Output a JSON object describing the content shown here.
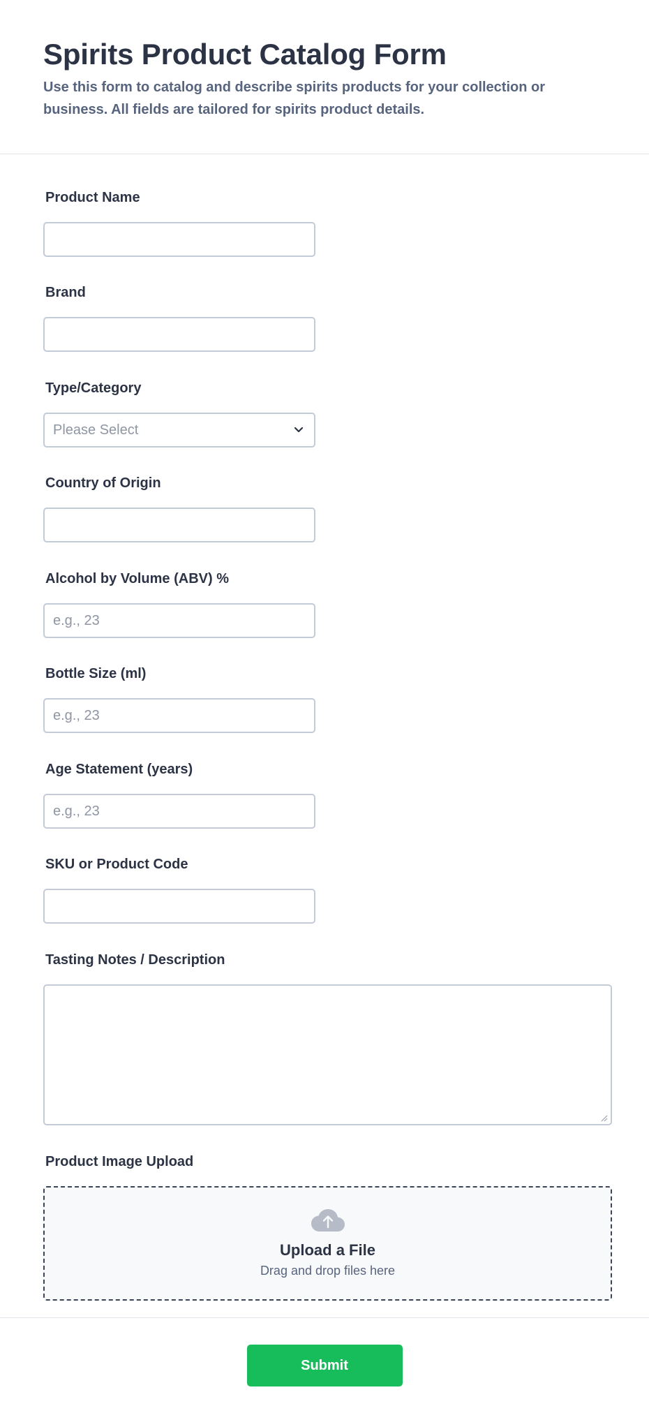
{
  "form": {
    "title": "Spirits Product Catalog Form",
    "subtitle": "Use this form to catalog and describe spirits products for your collection or business. All fields are tailored for spirits product details."
  },
  "fields": {
    "product_name": {
      "label": "Product Name",
      "value": ""
    },
    "brand": {
      "label": "Brand",
      "value": ""
    },
    "type_category": {
      "label": "Type/Category",
      "selected": "Please Select"
    },
    "country_of_origin": {
      "label": "Country of Origin",
      "value": ""
    },
    "abv": {
      "label": "Alcohol by Volume (ABV) %",
      "placeholder": "e.g., 23"
    },
    "bottle_size": {
      "label": "Bottle Size (ml)",
      "placeholder": "e.g., 23"
    },
    "age_statement": {
      "label": "Age Statement (years)",
      "placeholder": "e.g., 23"
    },
    "sku": {
      "label": "SKU or Product Code",
      "value": ""
    },
    "tasting_notes": {
      "label": "Tasting Notes / Description",
      "value": ""
    },
    "image_upload": {
      "label": "Product Image Upload",
      "title": "Upload a File",
      "subtitle": "Drag and drop files here",
      "icon": "cloud-upload-icon"
    }
  },
  "footer": {
    "submit_label": "Submit"
  },
  "colors": {
    "submit": "#18bd5b",
    "text": "#2c3345",
    "muted": "#57647e",
    "border": "#c3cad8"
  }
}
